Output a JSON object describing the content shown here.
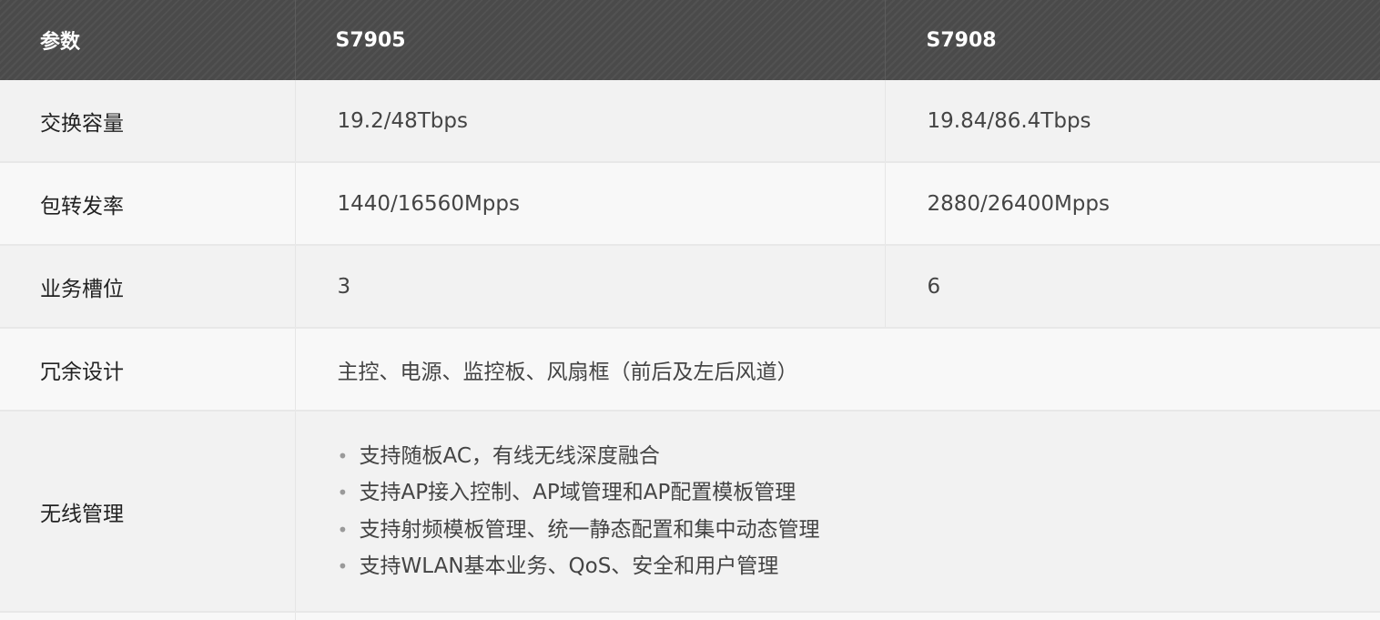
{
  "table": {
    "header": {
      "param": "参数",
      "model_a": "S7905",
      "model_b": "S7908"
    },
    "rows": [
      {
        "param": "交换容量",
        "a": "19.2/48Tbps",
        "b": "19.84/86.4Tbps"
      },
      {
        "param": "包转发率",
        "a": "1440/16560Mpps",
        "b": "2880/26400Mpps"
      },
      {
        "param": "业务槽位",
        "a": "3",
        "b": "6"
      }
    ],
    "redundancy": {
      "param": "冗余设计",
      "value": "主控、电源、监控板、风扇框（前后及左后风道）"
    },
    "wireless": {
      "param": "无线管理",
      "bullet": "•",
      "items": [
        "支持随板AC，有线无线深度融合",
        "支持AP接入控制、AP域管理和AP配置模板管理",
        "支持射频模板管理、统一静态配置和集中动态管理",
        "支持WLAN基本业务、QoS、安全和用户管理"
      ]
    }
  },
  "colors": {
    "header_bg": "#4a4a4a",
    "header_text": "#ffffff",
    "row_odd_bg": "#f2f2f2",
    "row_even_bg": "#f8f8f8",
    "text": "#333333",
    "bullet": "#9a9a9a"
  }
}
